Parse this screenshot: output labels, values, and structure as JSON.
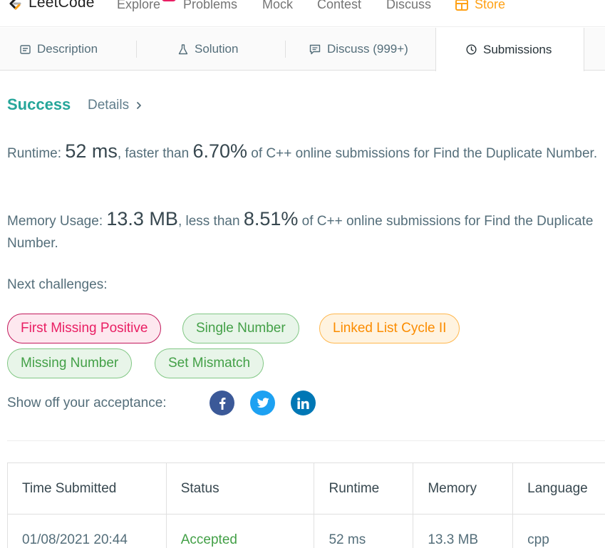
{
  "nav": {
    "logo_text": "LeetCode",
    "items": [
      "Explore",
      "Problems",
      "Mock",
      "Contest",
      "Discuss"
    ],
    "store_label": "Store",
    "accent": "#ffa116"
  },
  "tabs": {
    "description": "Description",
    "solution": "Solution",
    "discuss": "Discuss (999+)",
    "submissions": "Submissions"
  },
  "result": {
    "status": "Success",
    "details_label": "Details",
    "runtime_prefix": "Runtime: ",
    "runtime_value": "52 ms",
    "runtime_mid": ", faster than ",
    "runtime_percent": "6.70%",
    "runtime_suffix": " of C++ online submissions for Find the Duplicate Number.",
    "memory_prefix": "Memory Usage: ",
    "memory_value": "13.3 MB",
    "memory_mid": ", less than ",
    "memory_percent": "8.51%",
    "memory_suffix": " of C++ online submissions for Find the Duplicate Number.",
    "success_color": "#26a69a"
  },
  "next_challenges": {
    "label": "Next challenges:",
    "items": [
      {
        "name": "First Missing Positive",
        "difficulty": "hard"
      },
      {
        "name": "Single Number",
        "difficulty": "easy"
      },
      {
        "name": "Linked List Cycle II",
        "difficulty": "medium"
      },
      {
        "name": "Missing Number",
        "difficulty": "easy"
      },
      {
        "name": "Set Mismatch",
        "difficulty": "easy"
      }
    ]
  },
  "share": {
    "label": "Show off your acceptance:",
    "icons": [
      "facebook-icon",
      "twitter-icon",
      "linkedin-icon"
    ]
  },
  "table": {
    "headers": [
      "Time Submitted",
      "Status",
      "Runtime",
      "Memory",
      "Language"
    ],
    "rows": [
      [
        "01/08/2021 20:44",
        "Accepted",
        "52 ms",
        "13.3 MB",
        "cpp"
      ]
    ]
  }
}
